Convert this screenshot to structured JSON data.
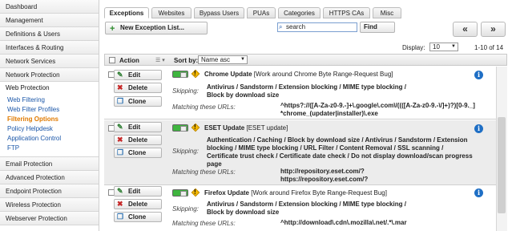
{
  "sidebar": {
    "items": [
      {
        "label": "Dashboard"
      },
      {
        "label": "Management"
      },
      {
        "label": "Definitions & Users"
      },
      {
        "label": "Interfaces & Routing"
      },
      {
        "label": "Network Services"
      },
      {
        "label": "Network Protection"
      }
    ],
    "active": {
      "label": "Web Protection",
      "subitems": [
        {
          "label": "Web Filtering"
        },
        {
          "label": "Web Filter Profiles"
        },
        {
          "label": "Filtering Options"
        },
        {
          "label": "Policy Helpdesk"
        },
        {
          "label": "Application Control"
        },
        {
          "label": "FTP"
        }
      ]
    },
    "bottom": [
      {
        "label": "Email Protection"
      },
      {
        "label": "Advanced Protection"
      },
      {
        "label": "Endpoint Protection"
      },
      {
        "label": "Wireless Protection"
      },
      {
        "label": "Webserver Protection"
      }
    ]
  },
  "tabs": [
    {
      "label": "Exceptions"
    },
    {
      "label": "Websites"
    },
    {
      "label": "Bypass Users"
    },
    {
      "label": "PUAs"
    },
    {
      "label": "Categories"
    },
    {
      "label": "HTTPS CAs"
    },
    {
      "label": "Misc"
    }
  ],
  "toolbar": {
    "new_label": "New Exception List...",
    "search_value": "search",
    "find_label": "Find",
    "display_label": "Display:",
    "display_value": "10",
    "page_info": "1-10 of 14",
    "prev_icon": "«",
    "next_icon": "»"
  },
  "list_header": {
    "action_label": "Action",
    "sort_label": "Sort by:",
    "sort_value": "Name asc"
  },
  "actions": {
    "edit": "Edit",
    "delete": "Delete",
    "clone": "Clone"
  },
  "rows": [
    {
      "name": "Chrome Update",
      "comment": "[Work around Chrome Byte Range-Request Bug]",
      "skipping_label": "Skipping:",
      "skipping": "Antivirus / Sandstorm / Extension blocking / MIME type blocking / Block by download size",
      "urls_label": "Matching these URLs:",
      "urls": [
        "^https?://([A-Za-z0-9.-]+\\.google\\.com\\/((([A-Za-z0-9.-\\/]+)?)[0-9._]*chrome_(updater|installer)\\.exe"
      ]
    },
    {
      "name": "ESET Update",
      "comment": "[ESET update]",
      "skipping_label": "Skipping:",
      "skipping": "Authentication / Caching / Block by download size / Antivirus / Sandstorm / Extension blocking / MIME type blocking / URL Filter / Content Removal / SSL scanning / Certificate trust check / Certificate date check / Do not display download/scan progress page",
      "urls_label": "Matching these URLs:",
      "urls": [
        "http://repository.eset.com/?",
        "https://repository.eset.com/?"
      ]
    },
    {
      "name": "Firefox Update",
      "comment": "[Work around Firefox Byte Range-Request Bug]",
      "skipping_label": "Skipping:",
      "skipping": "Antivirus / Sandstorm / Extension blocking / MIME type blocking / Block by download size",
      "urls_label": "Matching these URLs:",
      "urls": [
        "^http://download\\.cdn\\.mozilla\\.net/.*\\.mar"
      ]
    }
  ]
}
